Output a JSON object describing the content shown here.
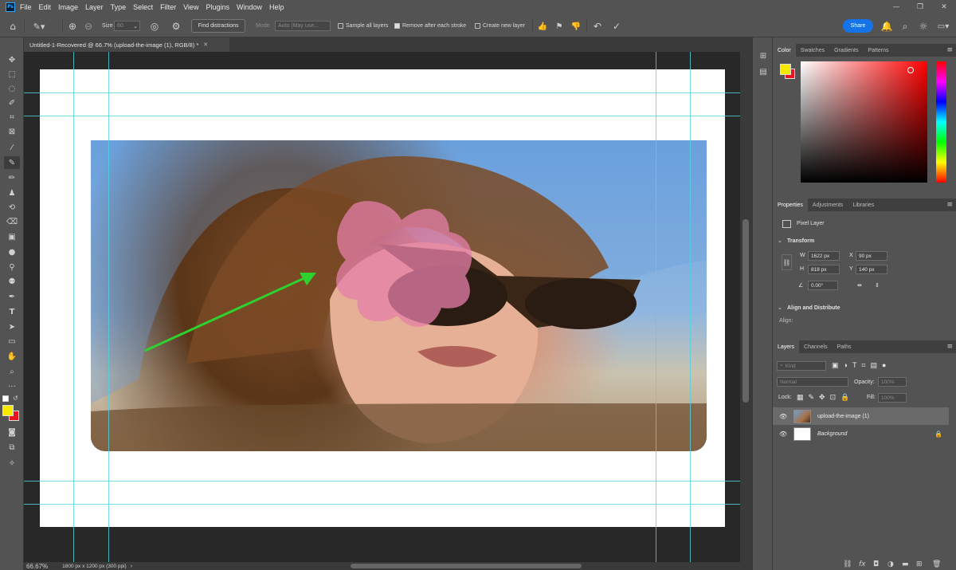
{
  "menubar": {
    "logo": "Ps",
    "items": [
      "File",
      "Edit",
      "Image",
      "Layer",
      "Type",
      "Select",
      "Filter",
      "View",
      "Plugins",
      "Window",
      "Help"
    ]
  },
  "options": {
    "size_label": "Size",
    "size_value": "60",
    "find_distractions": "Find distractions",
    "mode_label": "Mode",
    "mode_value": "Auto (May use...",
    "sample_all_layers": "Sample all layers",
    "remove_after_stroke": "Remove after each stroke",
    "create_new_layer": "Create new layer",
    "share": "Share"
  },
  "document": {
    "tab_title": "Untitled-1-Recovered @ 66.7% (upload-the-image (1), RGB/8) *",
    "zoom": "66.67%",
    "info": "1800 px x 1200 px (300 ppi)"
  },
  "color_panel": {
    "tabs": [
      "Color",
      "Swatches",
      "Gradients",
      "Patterns"
    ],
    "foreground": "#f5e900",
    "background": "#e8141e"
  },
  "properties_panel": {
    "tabs": [
      "Properties",
      "Adjustments",
      "Libraries"
    ],
    "layer_kind": "Pixel Layer",
    "transform_title": "Transform",
    "w_label": "W",
    "w_value": "1622 px",
    "h_label": "H",
    "h_value": "818 px",
    "x_label": "X",
    "x_value": "90 px",
    "y_label": "Y",
    "y_value": "140 px",
    "angle_value": "0.00°",
    "align_title": "Align and Distribute",
    "align_label": "Align:"
  },
  "layers_panel": {
    "tabs": [
      "Layers",
      "Channels",
      "Paths"
    ],
    "kind_placeholder": "Kind",
    "blend_mode": "Normal",
    "opacity_label": "Opacity:",
    "opacity_value": "100%",
    "lock_label": "Lock:",
    "fill_label": "Fill:",
    "fill_value": "100%",
    "layers": [
      {
        "name": "upload-the-image (1)"
      },
      {
        "name": "Background"
      }
    ]
  }
}
